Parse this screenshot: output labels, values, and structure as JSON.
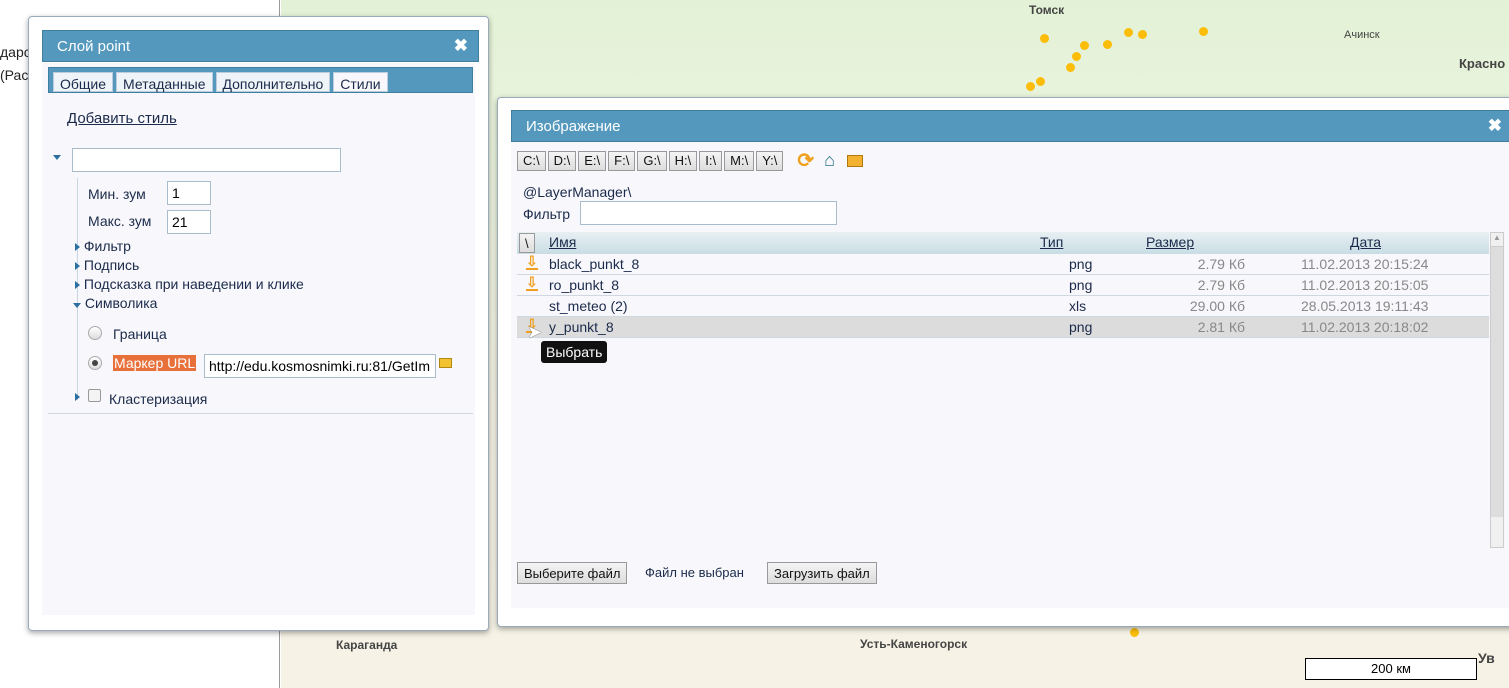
{
  "background": {
    "left_fragments": [
      "дарс",
      "(Рас"
    ],
    "cities": [
      "Томск",
      "Ачинск",
      "Красно",
      "Караганда",
      "Усть-Каменогорск",
      "Ув"
    ],
    "scale": "200 км"
  },
  "layer_dialog": {
    "title": "Слой point",
    "tabs": [
      "Общие",
      "Метаданные",
      "Дополнительно",
      "Стили"
    ],
    "active_tab": "Стили",
    "add_style": "Добавить стиль",
    "style_name": "",
    "min_zoom_label": "Мин. зум",
    "min_zoom": "1",
    "max_zoom_label": "Макс. зум",
    "max_zoom": "21",
    "nodes": [
      "Фильтр",
      "Подпись",
      "Подсказка при наведении и клике",
      "Символика"
    ],
    "border_label": "Граница",
    "marker_label": "Маркер URL",
    "marker_url": "http://edu.kosmosnimki.ru:81/GetIm",
    "clustering_label": "Кластеризация"
  },
  "image_dialog": {
    "title": "Изображение",
    "drives": [
      "C:\\",
      "D:\\",
      "E:\\",
      "F:\\",
      "G:\\",
      "H:\\",
      "I:\\",
      "M:\\",
      "Y:\\"
    ],
    "path": "@LayerManager\\",
    "filter_label": "Фильтр",
    "filter_value": "",
    "up_button": "\\",
    "columns": {
      "name": "Имя",
      "type": "Тип",
      "size": "Размер",
      "date": "Дата"
    },
    "files": [
      {
        "name": "black_punkt_8",
        "type": "png",
        "size": "2.79 Кб",
        "date": "11.02.2013 20:15:24",
        "icon": "download-icon"
      },
      {
        "name": "ro_punkt_8",
        "type": "png",
        "size": "2.79 Кб",
        "date": "11.02.2013 20:15:05",
        "icon": "download-icon"
      },
      {
        "name": "st_meteo (2)",
        "type": "xls",
        "size": "29.00 Кб",
        "date": "28.05.2013 19:11:43",
        "icon": ""
      },
      {
        "name": "y_punkt_8",
        "type": "png",
        "size": "2.81 Кб",
        "date": "11.02.2013 20:18:02",
        "icon": "download-icon"
      }
    ],
    "tooltip": "Выбрать",
    "choose_file": "Выберите файл",
    "no_file": "Файл не выбран",
    "upload": "Загрузить файл"
  },
  "colors": {
    "titlebar": "#5499bd",
    "highlight": "#e8703a",
    "dot": "#fbbd08"
  }
}
